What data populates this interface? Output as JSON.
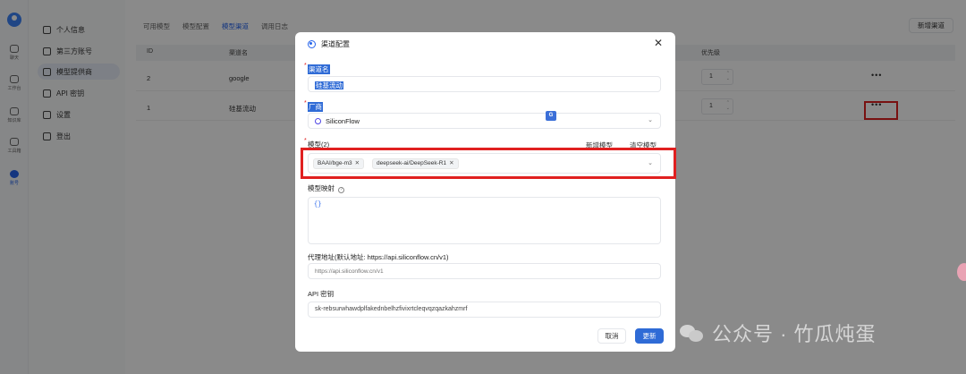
{
  "rail": {
    "items": [
      {
        "label": "聊天"
      },
      {
        "label": "工作台"
      },
      {
        "label": "知识库"
      },
      {
        "label": "工具箱"
      },
      {
        "label": "账号"
      }
    ]
  },
  "sidenav": {
    "items": [
      {
        "label": "个人信息"
      },
      {
        "label": "第三方账号"
      },
      {
        "label": "模型提供商"
      },
      {
        "label": "API 密钥"
      },
      {
        "label": "设置"
      },
      {
        "label": "登出"
      }
    ]
  },
  "main": {
    "tabs": [
      "可用模型",
      "模型配置",
      "模型渠道",
      "调用日志"
    ],
    "new_channel_label": "新增渠道",
    "columns": {
      "id": "ID",
      "name": "渠道名",
      "priority": "优先级"
    },
    "rows": [
      {
        "id": "2",
        "name": "google",
        "priority": "1",
        "more": "•••"
      },
      {
        "id": "1",
        "name": "硅基流动",
        "priority": "1",
        "more": "•••"
      }
    ]
  },
  "modal": {
    "title": "渠道配置",
    "close": "✕",
    "channel_name": {
      "label": "渠道名",
      "value": "硅基流动"
    },
    "provider": {
      "label": "厂商",
      "value": "SiliconFlow"
    },
    "models": {
      "label": "模型(2)",
      "add_label": "新增模型",
      "clear_label": "清空模型",
      "selected": [
        "BAAI/bge-m3",
        "deepseek-ai/DeepSeek-R1"
      ]
    },
    "model_mapping": {
      "label": "模型映射",
      "value": "{}"
    },
    "proxy": {
      "label": "代理地址(默认地址: https://api.siliconflow.cn/v1)",
      "placeholder": "https://api.siliconflow.cn/v1"
    },
    "api_key": {
      "label": "API 密钥",
      "value": "sk-rebsurwhawdplfakednbelhzfivixrtcleqvqzqazkahzmrf"
    },
    "cancel_label": "取消",
    "update_label": "更新"
  },
  "watermark": {
    "text": "公众号 · 竹瓜炖蛋"
  },
  "colors": {
    "primary": "#2f6bd6",
    "highlight": "#e02020"
  }
}
